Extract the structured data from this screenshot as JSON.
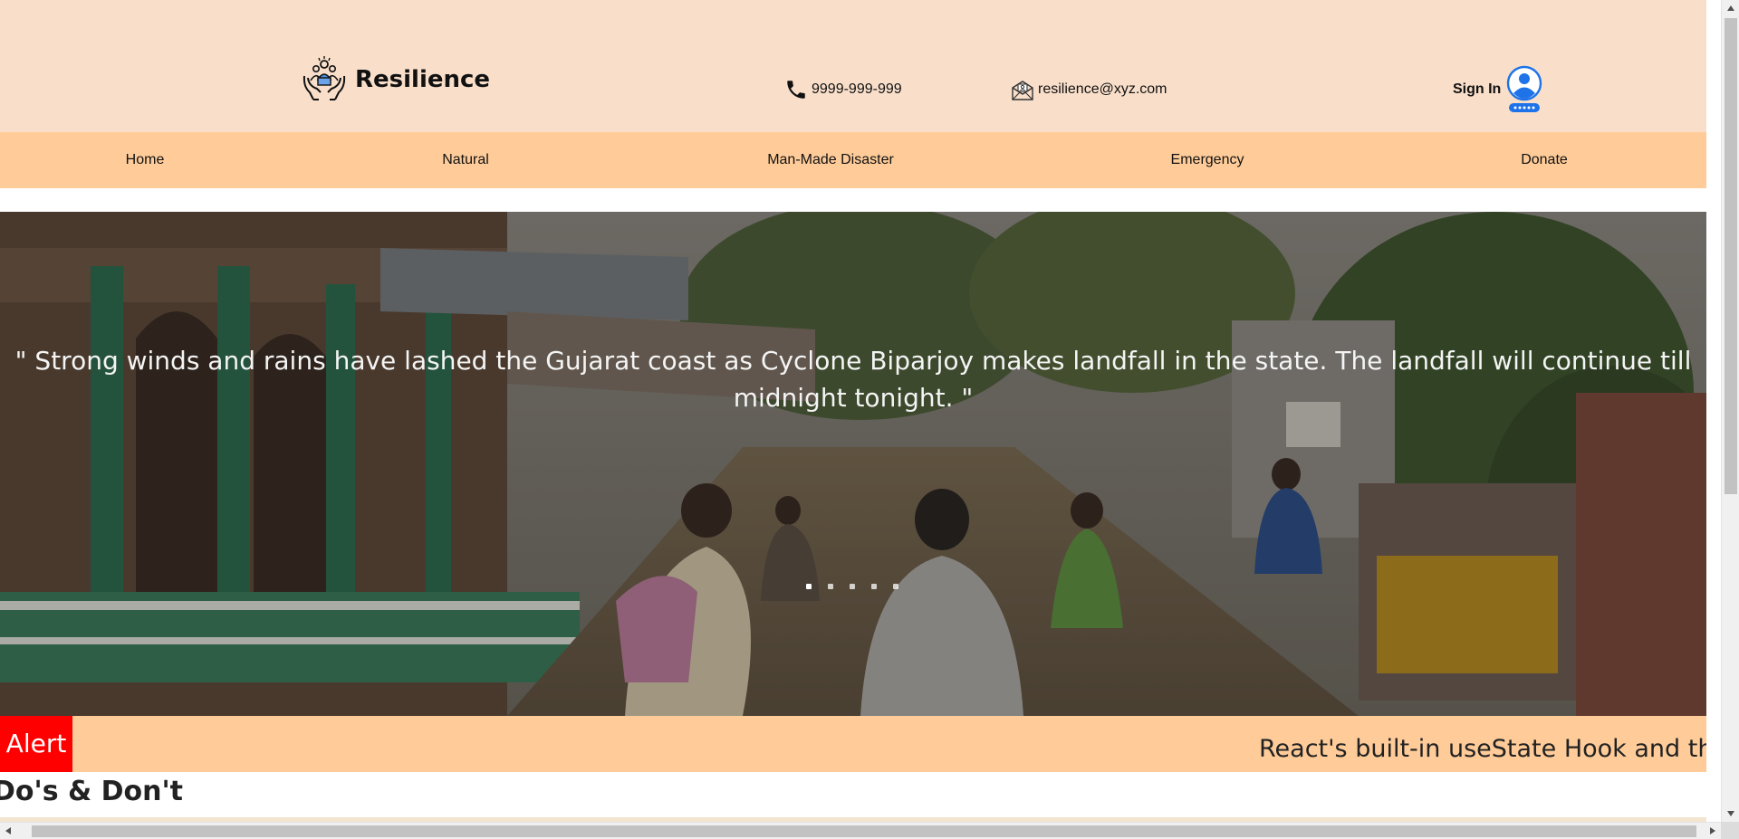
{
  "header": {
    "brand_name": "Resilience",
    "phone": "9999-999-999",
    "email": "resilience@xyz.com",
    "signin_label": "Sign In"
  },
  "nav": {
    "items": [
      {
        "label": "Home"
      },
      {
        "label": "Natural"
      },
      {
        "label": "Man-Made Disaster"
      },
      {
        "label": "Emergency"
      },
      {
        "label": "Donate"
      }
    ]
  },
  "hero": {
    "quote": "\" Strong winds and rains have lashed the Gujarat coast as Cyclone Biparjoy makes landfall in the state. The landfall will continue till midnight tonight. \"",
    "slide_count": 5,
    "active_slide": 1
  },
  "alert": {
    "label": "Alert",
    "ticker_text": "React's built-in useState Hook and the se"
  },
  "section": {
    "dos_title": "Do's & Don't"
  },
  "colors": {
    "header_bg": "#f9dfca",
    "nav_bg": "#ffcc99",
    "alert_red": "#ff0000",
    "avatar_blue": "#1e73e8"
  },
  "icons": {
    "logo": "hands-holding-family-icon",
    "phone": "phone-icon",
    "mail": "mail-icon",
    "avatar": "user-avatar-icon"
  }
}
